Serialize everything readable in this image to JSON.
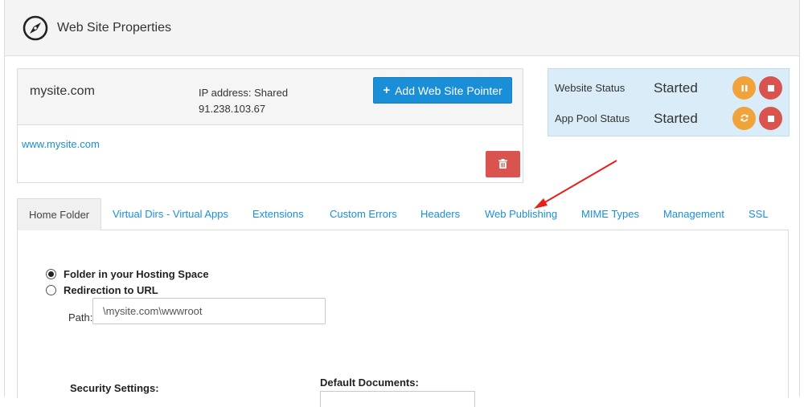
{
  "header": {
    "title": "Web Site Properties",
    "logo_icon": "compass-icon"
  },
  "site": {
    "name": "mysite.com",
    "ip_label": "IP address: Shared",
    "ip_value": "91.238.103.67",
    "add_pointer_label": "Add Web Site Pointer",
    "link": "www.mysite.com"
  },
  "status": {
    "website_label": "Website Status",
    "website_value": "Started",
    "apppool_label": "App Pool Status",
    "apppool_value": "Started"
  },
  "tabs": [
    {
      "label": "Home Folder"
    },
    {
      "label": "Virtual Dirs - Virtual Apps"
    },
    {
      "label": "Extensions"
    },
    {
      "label": "Custom Errors"
    },
    {
      "label": "Headers"
    },
    {
      "label": "Web Publishing"
    },
    {
      "label": "MIME Types"
    },
    {
      "label": "Management"
    },
    {
      "label": "SSL"
    }
  ],
  "home_folder": {
    "option_folder": "Folder in your Hosting Space",
    "option_redirect": "Redirection to URL",
    "path_label": "Path:",
    "path_value": "\\mysite.com\\wwwroot",
    "security_label": "Security Settings:",
    "docs_label": "Default Documents:"
  },
  "colors": {
    "accent": "#1a8fd8",
    "danger": "#d9534f",
    "warning": "#f0a33a",
    "status_bg": "#d9ecf7",
    "annotation_arrow": "#e8201c"
  }
}
